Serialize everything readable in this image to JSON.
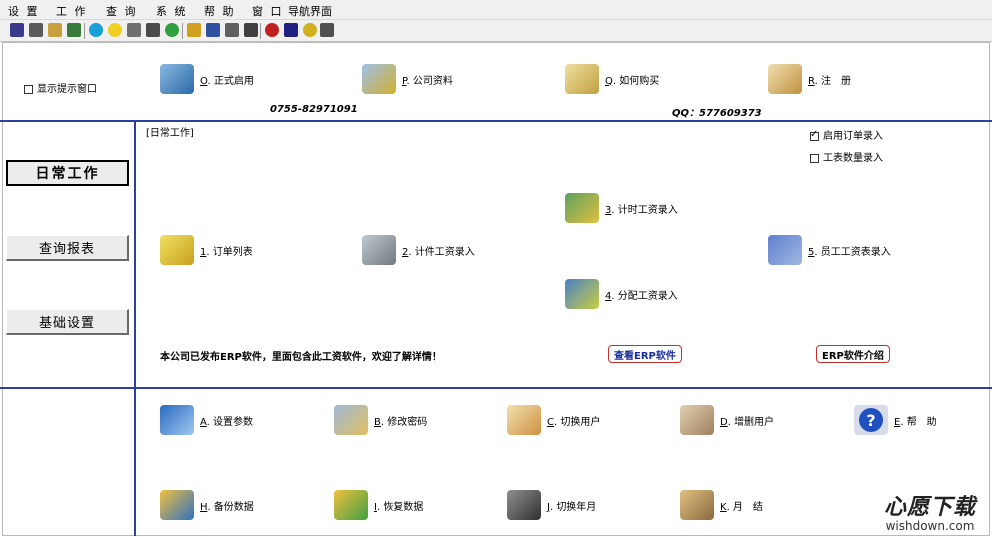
{
  "menu": [
    "设 置",
    "工 作",
    "查 询",
    "系 统",
    "帮 助",
    "窗 口",
    "导航界面"
  ],
  "top_panel": {
    "show_tip_label": "显示提示窗口",
    "actions": [
      {
        "key": "O",
        "label": "正式启用",
        "icon": "activate-icon"
      },
      {
        "key": "P",
        "label": "公司资料",
        "icon": "company-info-icon"
      },
      {
        "key": "Q",
        "label": "如何购买",
        "icon": "purchase-icon"
      },
      {
        "key": "R",
        "label": "注　册",
        "icon": "register-icon"
      }
    ],
    "phone": "0755-82971091",
    "qq": "QQ：577609373"
  },
  "left_nav": [
    "日常工作",
    "查询报表",
    "基础设置"
  ],
  "daily": {
    "section_title": "[日常工作]",
    "options": [
      {
        "label": "启用订单录入",
        "checked": true
      },
      {
        "label": "工表数量录入",
        "checked": false
      }
    ],
    "items": [
      {
        "key": "1",
        "label": "订单列表",
        "icon": "order-list-icon"
      },
      {
        "key": "2",
        "label": "计件工资录入",
        "icon": "piece-wage-icon"
      },
      {
        "key": "3",
        "label": "计时工资录入",
        "icon": "time-wage-icon"
      },
      {
        "key": "4",
        "label": "分配工资录入",
        "icon": "allocate-wage-icon"
      },
      {
        "key": "5",
        "label": "员工工资表录入",
        "icon": "employee-wage-icon"
      }
    ],
    "notice": "本公司已发布ERP软件，里面包含此工资软件，欢迎了解详情！",
    "view_erp": "查看ERP软件",
    "erp_intro": "ERP软件介绍"
  },
  "bottom": {
    "items": [
      {
        "key": "A",
        "label": "设置参数",
        "icon": "settings-icon"
      },
      {
        "key": "B",
        "label": "修改密码",
        "icon": "password-icon"
      },
      {
        "key": "C",
        "label": "切换用户",
        "icon": "switch-user-icon"
      },
      {
        "key": "D",
        "label": "增删用户",
        "icon": "manage-users-icon"
      },
      {
        "key": "E",
        "label": "帮　助",
        "icon": "help-icon"
      },
      {
        "key": "H",
        "label": "备份数据",
        "icon": "backup-icon"
      },
      {
        "key": "I",
        "label": "恢复数据",
        "icon": "restore-icon"
      },
      {
        "key": "J",
        "label": "切换年月",
        "icon": "switch-period-icon"
      },
      {
        "key": "K",
        "label": "月　结",
        "icon": "month-end-icon"
      }
    ]
  },
  "watermark": {
    "main": "心愿下载",
    "sub": "wishdown.com"
  }
}
